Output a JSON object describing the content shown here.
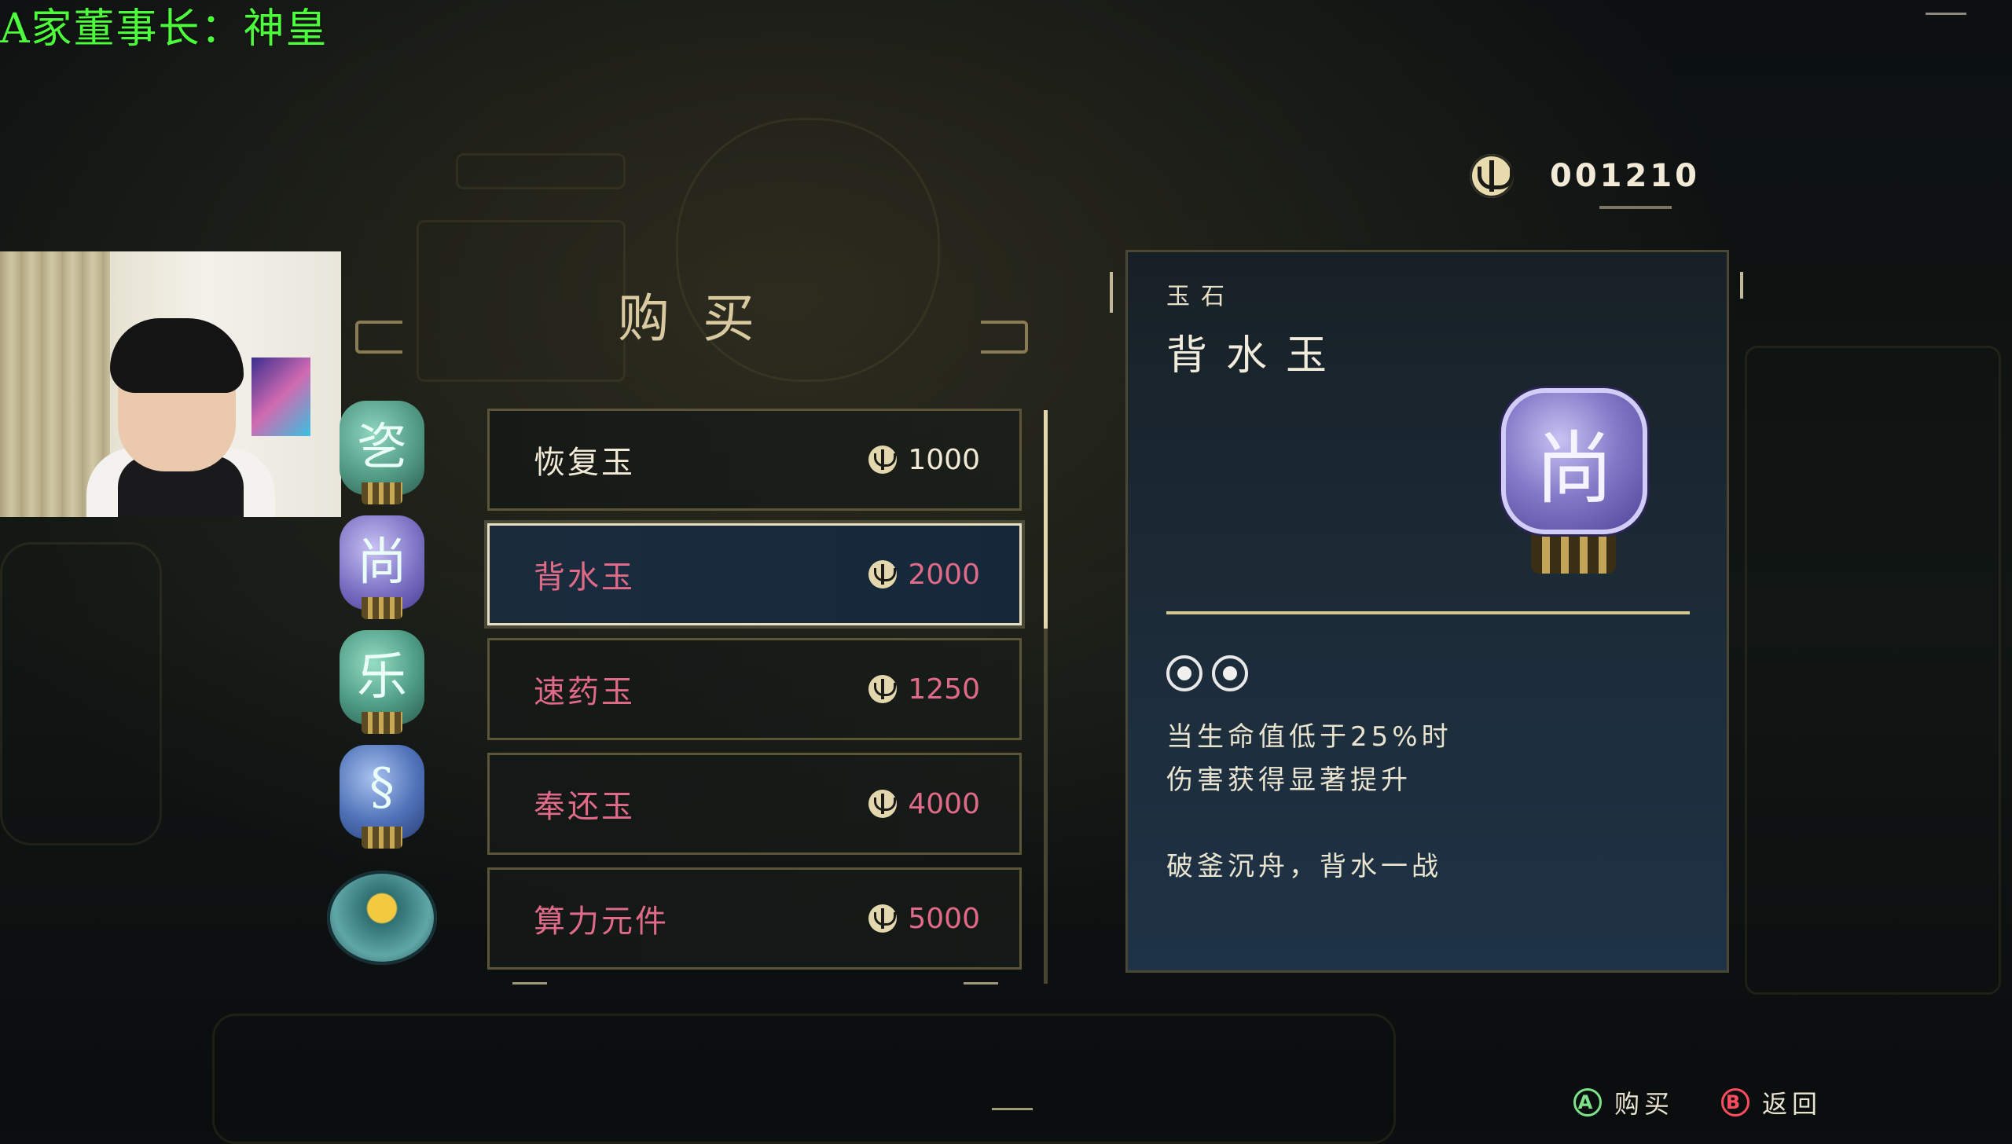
{
  "overlay": {
    "streamer_tag": "A家董事长：神皇"
  },
  "currency": {
    "amount": "001210",
    "icon": "coin-icon"
  },
  "shop": {
    "title": "购买"
  },
  "items": [
    {
      "name": "恢复玉",
      "price": "1000",
      "name_color": "#f2ead6",
      "price_color": "#f2ead6",
      "icon": "jade-green-icon",
      "icon_color": "#5aa58f",
      "glyph": "乲"
    },
    {
      "name": "背水玉",
      "price": "2000",
      "name_color": "#e06a88",
      "price_color": "#e06a88",
      "icon": "jade-purple-icon",
      "icon_color": "#7d74c6",
      "glyph": "尚",
      "selected": true
    },
    {
      "name": "速药玉",
      "price": "1250",
      "name_color": "#e06a88",
      "price_color": "#e06a88",
      "icon": "jade-teal-icon",
      "icon_color": "#4e9c85",
      "glyph": "乐"
    },
    {
      "name": "奉还玉",
      "price": "4000",
      "name_color": "#e06a88",
      "price_color": "#e06a88",
      "icon": "jade-blue-icon",
      "icon_color": "#4f72b8",
      "glyph": "§"
    },
    {
      "name": "算力元件",
      "price": "5000",
      "name_color": "#e06a88",
      "price_color": "#e06a88",
      "icon": "compute-module-icon",
      "icon_color": "#3b8a8c",
      "glyph": "◆"
    }
  ],
  "detail": {
    "category": "玉石",
    "name": "背水玉",
    "icon": "jade-purple-icon",
    "icon_glyph": "尚",
    "slots": 2,
    "effect_lines": [
      "当生命值低于25%时",
      "伤害获得显著提升"
    ],
    "flavor": "破釜沉舟，背水一战"
  },
  "hints": [
    {
      "button": "A",
      "label": "购买",
      "icon": "a-button-icon"
    },
    {
      "button": "B",
      "label": "返回",
      "icon": "b-button-icon"
    }
  ]
}
